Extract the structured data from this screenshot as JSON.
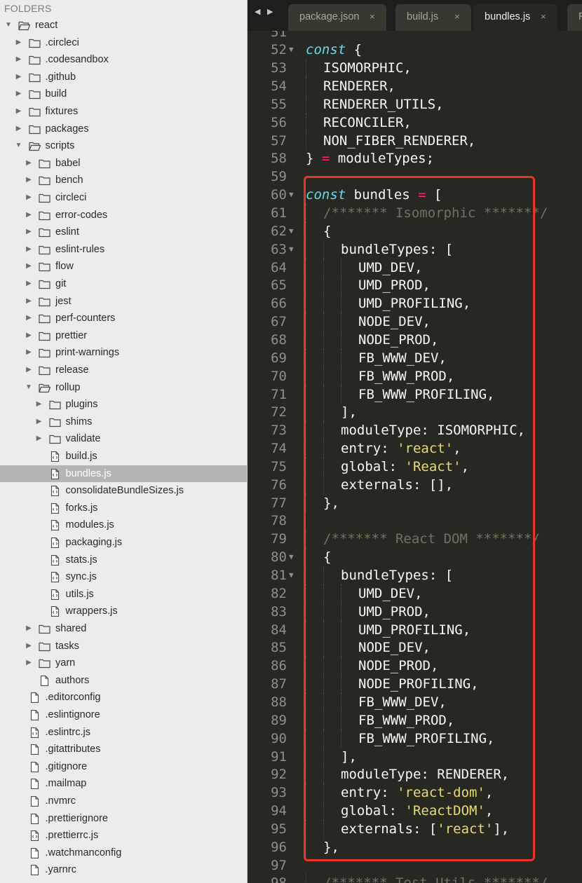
{
  "sidebar": {
    "header": "FOLDERS",
    "items": [
      {
        "label": "react",
        "kind": "folder",
        "depth": 0,
        "expanded": true
      },
      {
        "label": ".circleci",
        "kind": "folder",
        "depth": 1,
        "expanded": false
      },
      {
        "label": ".codesandbox",
        "kind": "folder",
        "depth": 1,
        "expanded": false
      },
      {
        "label": ".github",
        "kind": "folder",
        "depth": 1,
        "expanded": false
      },
      {
        "label": "build",
        "kind": "folder",
        "depth": 1,
        "expanded": false
      },
      {
        "label": "fixtures",
        "kind": "folder",
        "depth": 1,
        "expanded": false
      },
      {
        "label": "packages",
        "kind": "folder",
        "depth": 1,
        "expanded": false
      },
      {
        "label": "scripts",
        "kind": "folder",
        "depth": 1,
        "expanded": true
      },
      {
        "label": "babel",
        "kind": "folder",
        "depth": 2,
        "expanded": false
      },
      {
        "label": "bench",
        "kind": "folder",
        "depth": 2,
        "expanded": false
      },
      {
        "label": "circleci",
        "kind": "folder",
        "depth": 2,
        "expanded": false
      },
      {
        "label": "error-codes",
        "kind": "folder",
        "depth": 2,
        "expanded": false
      },
      {
        "label": "eslint",
        "kind": "folder",
        "depth": 2,
        "expanded": false
      },
      {
        "label": "eslint-rules",
        "kind": "folder",
        "depth": 2,
        "expanded": false
      },
      {
        "label": "flow",
        "kind": "folder",
        "depth": 2,
        "expanded": false
      },
      {
        "label": "git",
        "kind": "folder",
        "depth": 2,
        "expanded": false
      },
      {
        "label": "jest",
        "kind": "folder",
        "depth": 2,
        "expanded": false
      },
      {
        "label": "perf-counters",
        "kind": "folder",
        "depth": 2,
        "expanded": false
      },
      {
        "label": "prettier",
        "kind": "folder",
        "depth": 2,
        "expanded": false
      },
      {
        "label": "print-warnings",
        "kind": "folder",
        "depth": 2,
        "expanded": false
      },
      {
        "label": "release",
        "kind": "folder",
        "depth": 2,
        "expanded": false
      },
      {
        "label": "rollup",
        "kind": "folder",
        "depth": 2,
        "expanded": true
      },
      {
        "label": "plugins",
        "kind": "folder",
        "depth": 3,
        "expanded": false
      },
      {
        "label": "shims",
        "kind": "folder",
        "depth": 3,
        "expanded": false
      },
      {
        "label": "validate",
        "kind": "folder",
        "depth": 3,
        "expanded": false
      },
      {
        "label": "build.js",
        "kind": "code-file",
        "depth": 3
      },
      {
        "label": "bundles.js",
        "kind": "code-file",
        "depth": 3,
        "selected": true
      },
      {
        "label": "consolidateBundleSizes.js",
        "kind": "code-file",
        "depth": 3
      },
      {
        "label": "forks.js",
        "kind": "code-file",
        "depth": 3
      },
      {
        "label": "modules.js",
        "kind": "code-file",
        "depth": 3
      },
      {
        "label": "packaging.js",
        "kind": "code-file",
        "depth": 3
      },
      {
        "label": "stats.js",
        "kind": "code-file",
        "depth": 3
      },
      {
        "label": "sync.js",
        "kind": "code-file",
        "depth": 3
      },
      {
        "label": "utils.js",
        "kind": "code-file",
        "depth": 3
      },
      {
        "label": "wrappers.js",
        "kind": "code-file",
        "depth": 3
      },
      {
        "label": "shared",
        "kind": "folder",
        "depth": 2,
        "expanded": false
      },
      {
        "label": "tasks",
        "kind": "folder",
        "depth": 2,
        "expanded": false
      },
      {
        "label": "yarn",
        "kind": "folder",
        "depth": 2,
        "expanded": false
      },
      {
        "label": "authors",
        "kind": "file",
        "depth": 2
      },
      {
        "label": ".editorconfig",
        "kind": "file",
        "depth": 1
      },
      {
        "label": ".eslintignore",
        "kind": "file",
        "depth": 1
      },
      {
        "label": ".eslintrc.js",
        "kind": "code-file",
        "depth": 1
      },
      {
        "label": ".gitattributes",
        "kind": "file",
        "depth": 1
      },
      {
        "label": ".gitignore",
        "kind": "file",
        "depth": 1
      },
      {
        "label": ".mailmap",
        "kind": "file",
        "depth": 1
      },
      {
        "label": ".nvmrc",
        "kind": "file",
        "depth": 1
      },
      {
        "label": ".prettierignore",
        "kind": "file",
        "depth": 1
      },
      {
        "label": ".prettierrc.js",
        "kind": "code-file",
        "depth": 1
      },
      {
        "label": ".watchmanconfig",
        "kind": "file",
        "depth": 1
      },
      {
        "label": ".yarnrc",
        "kind": "file",
        "depth": 1
      }
    ]
  },
  "tabs": [
    {
      "label": "package.json",
      "active": false
    },
    {
      "label": "build.js",
      "active": false
    },
    {
      "label": "bundles.js",
      "active": true
    },
    {
      "label": "R",
      "active": false
    }
  ],
  "tab_close_glyph": "×",
  "nav": {
    "back": "◀",
    "forward": "▶"
  },
  "colors": {
    "editor_bg": "#272822",
    "keyword": "#66d9ef",
    "operator": "#f92672",
    "string": "#e6db74",
    "comment": "#75715e",
    "highlight_box": "#e8352b"
  },
  "editor": {
    "lines": [
      {
        "n": "51",
        "fold": false,
        "indent": 0,
        "tokens": []
      },
      {
        "n": "52",
        "fold": true,
        "indent": 0,
        "tokens": [
          {
            "t": "const",
            "c": "kw"
          },
          {
            "t": " {",
            "c": ""
          }
        ]
      },
      {
        "n": "53",
        "fold": false,
        "indent": 1,
        "tokens": [
          {
            "t": "ISOMORPHIC,",
            "c": ""
          }
        ]
      },
      {
        "n": "54",
        "fold": false,
        "indent": 1,
        "tokens": [
          {
            "t": "RENDERER,",
            "c": ""
          }
        ]
      },
      {
        "n": "55",
        "fold": false,
        "indent": 1,
        "tokens": [
          {
            "t": "RENDERER_UTILS,",
            "c": ""
          }
        ]
      },
      {
        "n": "56",
        "fold": false,
        "indent": 1,
        "tokens": [
          {
            "t": "RECONCILER,",
            "c": ""
          }
        ]
      },
      {
        "n": "57",
        "fold": false,
        "indent": 1,
        "tokens": [
          {
            "t": "NON_FIBER_RENDERER,",
            "c": ""
          }
        ]
      },
      {
        "n": "58",
        "fold": false,
        "indent": 0,
        "tokens": [
          {
            "t": "} ",
            "c": ""
          },
          {
            "t": "=",
            "c": "op"
          },
          {
            "t": " moduleTypes;",
            "c": ""
          }
        ]
      },
      {
        "n": "59",
        "fold": false,
        "indent": 0,
        "tokens": []
      },
      {
        "n": "60",
        "fold": true,
        "indent": 0,
        "tokens": [
          {
            "t": "const",
            "c": "kw"
          },
          {
            "t": " bundles ",
            "c": ""
          },
          {
            "t": "=",
            "c": "op"
          },
          {
            "t": " [",
            "c": ""
          }
        ]
      },
      {
        "n": "61",
        "fold": false,
        "indent": 1,
        "tokens": [
          {
            "t": "/******* Isomorphic *******/",
            "c": "com"
          }
        ]
      },
      {
        "n": "62",
        "fold": true,
        "indent": 1,
        "tokens": [
          {
            "t": "{",
            "c": ""
          }
        ]
      },
      {
        "n": "63",
        "fold": true,
        "indent": 2,
        "tokens": [
          {
            "t": "bundleTypes: [",
            "c": ""
          }
        ]
      },
      {
        "n": "64",
        "fold": false,
        "indent": 3,
        "tokens": [
          {
            "t": "UMD_DEV,",
            "c": ""
          }
        ]
      },
      {
        "n": "65",
        "fold": false,
        "indent": 3,
        "tokens": [
          {
            "t": "UMD_PROD,",
            "c": ""
          }
        ]
      },
      {
        "n": "66",
        "fold": false,
        "indent": 3,
        "tokens": [
          {
            "t": "UMD_PROFILING,",
            "c": ""
          }
        ]
      },
      {
        "n": "67",
        "fold": false,
        "indent": 3,
        "tokens": [
          {
            "t": "NODE_DEV,",
            "c": ""
          }
        ]
      },
      {
        "n": "68",
        "fold": false,
        "indent": 3,
        "tokens": [
          {
            "t": "NODE_PROD,",
            "c": ""
          }
        ]
      },
      {
        "n": "69",
        "fold": false,
        "indent": 3,
        "tokens": [
          {
            "t": "FB_WWW_DEV,",
            "c": ""
          }
        ]
      },
      {
        "n": "70",
        "fold": false,
        "indent": 3,
        "tokens": [
          {
            "t": "FB_WWW_PROD,",
            "c": ""
          }
        ]
      },
      {
        "n": "71",
        "fold": false,
        "indent": 3,
        "tokens": [
          {
            "t": "FB_WWW_PROFILING,",
            "c": ""
          }
        ]
      },
      {
        "n": "72",
        "fold": false,
        "indent": 2,
        "tokens": [
          {
            "t": "],",
            "c": ""
          }
        ]
      },
      {
        "n": "73",
        "fold": false,
        "indent": 2,
        "tokens": [
          {
            "t": "moduleType: ISOMORPHIC,",
            "c": ""
          }
        ]
      },
      {
        "n": "74",
        "fold": false,
        "indent": 2,
        "tokens": [
          {
            "t": "entry: ",
            "c": ""
          },
          {
            "t": "'react'",
            "c": "str"
          },
          {
            "t": ",",
            "c": ""
          }
        ]
      },
      {
        "n": "75",
        "fold": false,
        "indent": 2,
        "tokens": [
          {
            "t": "global: ",
            "c": ""
          },
          {
            "t": "'React'",
            "c": "str"
          },
          {
            "t": ",",
            "c": ""
          }
        ]
      },
      {
        "n": "76",
        "fold": false,
        "indent": 2,
        "tokens": [
          {
            "t": "externals: [],",
            "c": ""
          }
        ]
      },
      {
        "n": "77",
        "fold": false,
        "indent": 1,
        "tokens": [
          {
            "t": "},",
            "c": ""
          }
        ]
      },
      {
        "n": "78",
        "fold": false,
        "indent": 0,
        "tokens": []
      },
      {
        "n": "79",
        "fold": false,
        "indent": 1,
        "tokens": [
          {
            "t": "/******* React DOM *******/",
            "c": "com"
          }
        ]
      },
      {
        "n": "80",
        "fold": true,
        "indent": 1,
        "tokens": [
          {
            "t": "{",
            "c": ""
          }
        ]
      },
      {
        "n": "81",
        "fold": true,
        "indent": 2,
        "tokens": [
          {
            "t": "bundleTypes: [",
            "c": ""
          }
        ]
      },
      {
        "n": "82",
        "fold": false,
        "indent": 3,
        "tokens": [
          {
            "t": "UMD_DEV,",
            "c": ""
          }
        ]
      },
      {
        "n": "83",
        "fold": false,
        "indent": 3,
        "tokens": [
          {
            "t": "UMD_PROD,",
            "c": ""
          }
        ]
      },
      {
        "n": "84",
        "fold": false,
        "indent": 3,
        "tokens": [
          {
            "t": "UMD_PROFILING,",
            "c": ""
          }
        ]
      },
      {
        "n": "85",
        "fold": false,
        "indent": 3,
        "tokens": [
          {
            "t": "NODE_DEV,",
            "c": ""
          }
        ]
      },
      {
        "n": "86",
        "fold": false,
        "indent": 3,
        "tokens": [
          {
            "t": "NODE_PROD,",
            "c": ""
          }
        ]
      },
      {
        "n": "87",
        "fold": false,
        "indent": 3,
        "tokens": [
          {
            "t": "NODE_PROFILING,",
            "c": ""
          }
        ]
      },
      {
        "n": "88",
        "fold": false,
        "indent": 3,
        "tokens": [
          {
            "t": "FB_WWW_DEV,",
            "c": ""
          }
        ]
      },
      {
        "n": "89",
        "fold": false,
        "indent": 3,
        "tokens": [
          {
            "t": "FB_WWW_PROD,",
            "c": ""
          }
        ]
      },
      {
        "n": "90",
        "fold": false,
        "indent": 3,
        "tokens": [
          {
            "t": "FB_WWW_PROFILING,",
            "c": ""
          }
        ]
      },
      {
        "n": "91",
        "fold": false,
        "indent": 2,
        "tokens": [
          {
            "t": "],",
            "c": ""
          }
        ]
      },
      {
        "n": "92",
        "fold": false,
        "indent": 2,
        "tokens": [
          {
            "t": "moduleType: RENDERER,",
            "c": ""
          }
        ]
      },
      {
        "n": "93",
        "fold": false,
        "indent": 2,
        "tokens": [
          {
            "t": "entry: ",
            "c": ""
          },
          {
            "t": "'react-dom'",
            "c": "str"
          },
          {
            "t": ",",
            "c": ""
          }
        ]
      },
      {
        "n": "94",
        "fold": false,
        "indent": 2,
        "tokens": [
          {
            "t": "global: ",
            "c": ""
          },
          {
            "t": "'ReactDOM'",
            "c": "str"
          },
          {
            "t": ",",
            "c": ""
          }
        ]
      },
      {
        "n": "95",
        "fold": false,
        "indent": 2,
        "tokens": [
          {
            "t": "externals: [",
            "c": ""
          },
          {
            "t": "'react'",
            "c": "str"
          },
          {
            "t": "],",
            "c": ""
          }
        ]
      },
      {
        "n": "96",
        "fold": false,
        "indent": 1,
        "tokens": [
          {
            "t": "},",
            "c": ""
          }
        ]
      },
      {
        "n": "97",
        "fold": false,
        "indent": 0,
        "tokens": []
      },
      {
        "n": "98",
        "fold": false,
        "indent": 1,
        "tokens": [
          {
            "t": "/******* Test Utils *******/",
            "c": "com"
          }
        ]
      }
    ]
  }
}
